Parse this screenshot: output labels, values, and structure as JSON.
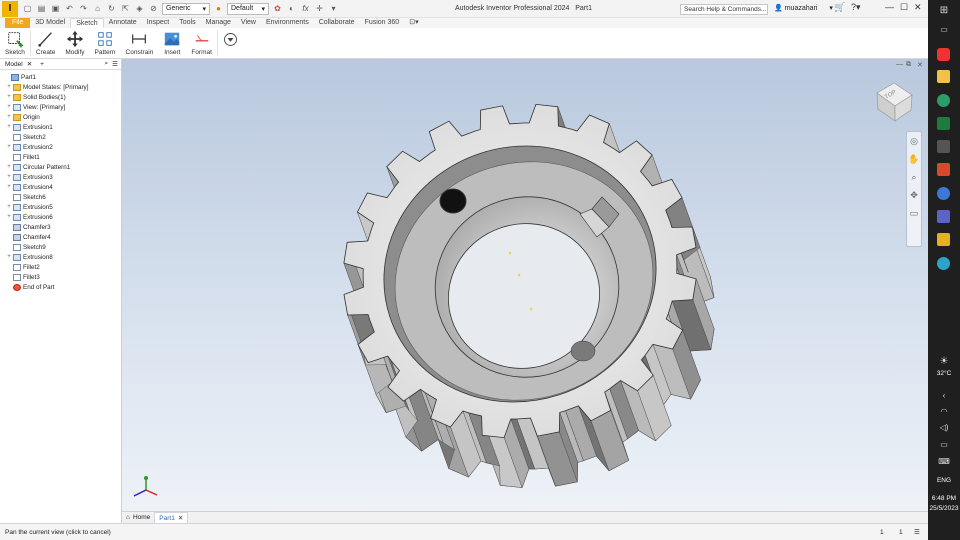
{
  "titlebar": {
    "app_title": "Autodesk Inventor Professional 2024",
    "doc_title": "Part1",
    "appearance_combo": "Generic",
    "material_combo": "Default",
    "search_placeholder": "Search Help & Commands...",
    "user_name": "muazahari"
  },
  "ribbon_tabs": [
    "File",
    "3D Model",
    "Sketch",
    "Annotate",
    "Inspect",
    "Tools",
    "Manage",
    "View",
    "Environments",
    "Collaborate",
    "Fusion 360"
  ],
  "active_tab": "Sketch",
  "ribbon_buttons": [
    {
      "label": "Sketch",
      "icon": "sketch-icon"
    },
    {
      "label": "Create",
      "icon": "create-icon"
    },
    {
      "label": "Modify",
      "icon": "modify-move-icon"
    },
    {
      "label": "Pattern",
      "icon": "pattern-icon"
    },
    {
      "label": "Constrain",
      "icon": "constrain-icon"
    },
    {
      "label": "Insert",
      "icon": "insert-image-icon"
    },
    {
      "label": "Format",
      "icon": "format-icon"
    }
  ],
  "browser": {
    "tab_label": "Model",
    "tree": [
      {
        "label": "Part1",
        "icon": "part",
        "expand": "",
        "indent": 0
      },
      {
        "label": "Model States: [Primary]",
        "icon": "folder",
        "expand": "+",
        "indent": 1
      },
      {
        "label": "Solid Bodies(1)",
        "icon": "folder",
        "expand": "+",
        "indent": 1
      },
      {
        "label": "View: [Primary]",
        "icon": "view",
        "expand": "+",
        "indent": 1
      },
      {
        "label": "Origin",
        "icon": "folder",
        "expand": "+",
        "indent": 1
      },
      {
        "label": "Extrusion1",
        "icon": "feature",
        "expand": "+",
        "indent": 1
      },
      {
        "label": "Sketch2",
        "icon": "sketch",
        "expand": "",
        "indent": 1
      },
      {
        "label": "Extrusion2",
        "icon": "feature",
        "expand": "+",
        "indent": 1
      },
      {
        "label": "Fillet1",
        "icon": "sketch",
        "expand": "",
        "indent": 1
      },
      {
        "label": "Circular Pattern1",
        "icon": "feature",
        "expand": "+",
        "indent": 1
      },
      {
        "label": "Extrusion3",
        "icon": "feature",
        "expand": "+",
        "indent": 1
      },
      {
        "label": "Extrusion4",
        "icon": "feature",
        "expand": "+",
        "indent": 1
      },
      {
        "label": "Sketch6",
        "icon": "sketch",
        "expand": "",
        "indent": 1
      },
      {
        "label": "Extrusion5",
        "icon": "feature",
        "expand": "+",
        "indent": 1
      },
      {
        "label": "Extrusion6",
        "icon": "feature",
        "expand": "+",
        "indent": 1
      },
      {
        "label": "Chamfer3",
        "icon": "chamfer",
        "expand": "",
        "indent": 1
      },
      {
        "label": "Chamfer4",
        "icon": "chamfer",
        "expand": "",
        "indent": 1
      },
      {
        "label": "Sketch9",
        "icon": "sketch",
        "expand": "",
        "indent": 1
      },
      {
        "label": "Extrusion8",
        "icon": "feature",
        "expand": "+",
        "indent": 1
      },
      {
        "label": "Fillet2",
        "icon": "sketch",
        "expand": "",
        "indent": 1
      },
      {
        "label": "Fillet3",
        "icon": "sketch",
        "expand": "",
        "indent": 1
      },
      {
        "label": "End of Part",
        "icon": "stop",
        "expand": "",
        "indent": 1
      }
    ]
  },
  "viewcube_label": "TOP",
  "doc_tabs": [
    "Home",
    "Part1"
  ],
  "active_doc_tab": "Part1",
  "status": {
    "message": "Pan the current view (click to cancel)",
    "count_a": "1",
    "count_b": "1"
  },
  "taskbar": {
    "weather": "32°C",
    "language": "ENG",
    "time": "6:48 PM",
    "date": "25/5/2023"
  },
  "colors": {
    "file_tab": "#f0a81c",
    "accent": "#2a6fb8",
    "viewport_top": "#b9c8de",
    "viewport_bottom": "#eef2f7"
  }
}
